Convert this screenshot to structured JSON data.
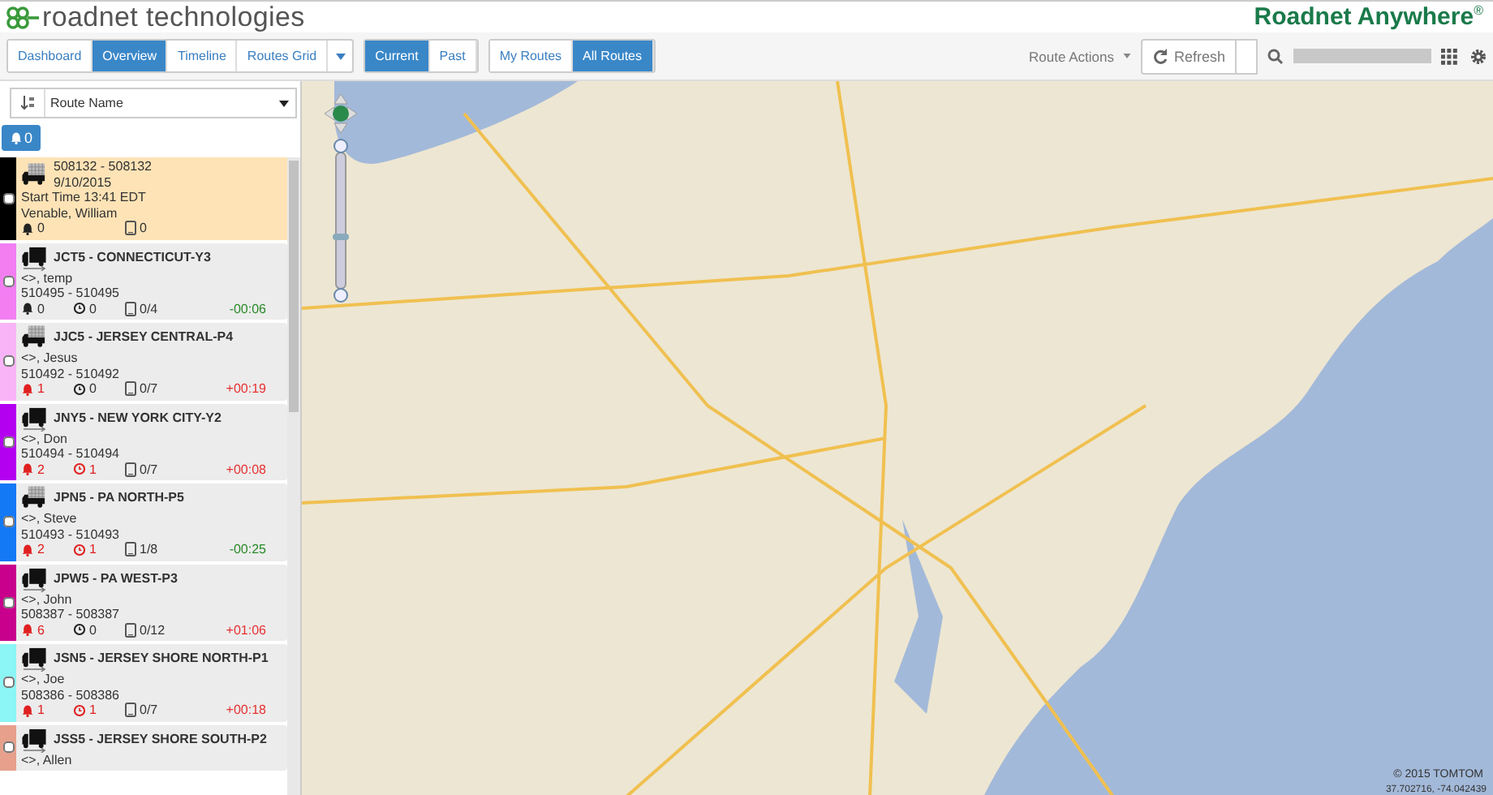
{
  "header": {
    "logo_text": "roadnet technologies",
    "product": "Roadnet Anywhere",
    "product_mark": "®"
  },
  "toolbar": {
    "view_tabs": [
      {
        "label": "Dashboard",
        "selected": false
      },
      {
        "label": "Overview",
        "selected": true
      },
      {
        "label": "Timeline",
        "selected": false
      },
      {
        "label": "Routes Grid",
        "selected": false
      }
    ],
    "time_tabs": [
      {
        "label": "Current",
        "selected": true
      },
      {
        "label": "Past",
        "selected": false
      }
    ],
    "owner_tabs": [
      {
        "label": "My Routes",
        "selected": false
      },
      {
        "label": "All Routes",
        "selected": true
      }
    ],
    "route_actions": "Route Actions",
    "refresh": "Refresh"
  },
  "sidebar": {
    "sort_select": "Route Name",
    "alert_button": "0",
    "routes": [
      {
        "kind": "pending",
        "color": "#000000",
        "selected": true,
        "lines": [
          "508132 - 508132",
          "9/10/2015",
          "Start Time 13:41 EDT",
          "Venable, William"
        ],
        "alerts": "0",
        "alerts_active": false,
        "stops": "0"
      },
      {
        "kind": "active",
        "color": "#f27ef2",
        "selected": false,
        "name": "JCT5 - CONNECTICUT-Y3",
        "lines": [
          "<>, temp",
          "510495 - 510495"
        ],
        "alerts": "0",
        "alerts_active": false,
        "timers": "0",
        "timers_active": false,
        "stops": "0/4",
        "variance": "-00:06",
        "late": false
      },
      {
        "kind": "pending",
        "color": "#f9b4f7",
        "selected": false,
        "name": "JJC5 - JERSEY CENTRAL-P4",
        "lines": [
          "<>, Jesus",
          "510492 - 510492"
        ],
        "alerts": "1",
        "alerts_active": true,
        "timers": "0",
        "timers_active": false,
        "stops": "0/7",
        "variance": "+00:19",
        "late": true
      },
      {
        "kind": "active",
        "color": "#b400f0",
        "selected": false,
        "name": "JNY5 - NEW YORK CITY-Y2",
        "lines": [
          "<>, Don",
          "510494 - 510494"
        ],
        "alerts": "2",
        "alerts_active": true,
        "timers": "1",
        "timers_active": true,
        "stops": "0/7",
        "variance": "+00:08",
        "late": true
      },
      {
        "kind": "pending",
        "color": "#1479f5",
        "selected": false,
        "name": "JPN5 - PA NORTH-P5",
        "lines": [
          "<>, Steve",
          "510493 - 510493"
        ],
        "alerts": "2",
        "alerts_active": true,
        "timers": "1",
        "timers_active": true,
        "stops": "1/8",
        "variance": "-00:25",
        "late": false
      },
      {
        "kind": "active",
        "color": "#c8008c",
        "selected": false,
        "name": "JPW5 - PA WEST-P3",
        "lines": [
          "<>, John",
          "508387 - 508387"
        ],
        "alerts": "6",
        "alerts_active": true,
        "timers": "0",
        "timers_active": false,
        "stops": "0/12",
        "variance": "+01:06",
        "late": true
      },
      {
        "kind": "active",
        "color": "#8cf5f5",
        "selected": false,
        "name": "JSN5 - JERSEY SHORE NORTH-P1",
        "lines": [
          "<>, Joe",
          "508386 - 508386"
        ],
        "alerts": "1",
        "alerts_active": true,
        "timers": "1",
        "timers_active": true,
        "stops": "0/7",
        "variance": "+00:18",
        "late": true
      },
      {
        "kind": "active",
        "color": "#e6a08c",
        "selected": false,
        "name": "JSS5 - JERSEY SHORE SOUTH-P2",
        "lines": [
          "<>, Allen"
        ]
      }
    ]
  },
  "map": {
    "zoom": {
      "level": 0.4
    },
    "copyright": "© 2015 TOMTOM",
    "coordinates": "37.702716, -74.042439"
  }
}
